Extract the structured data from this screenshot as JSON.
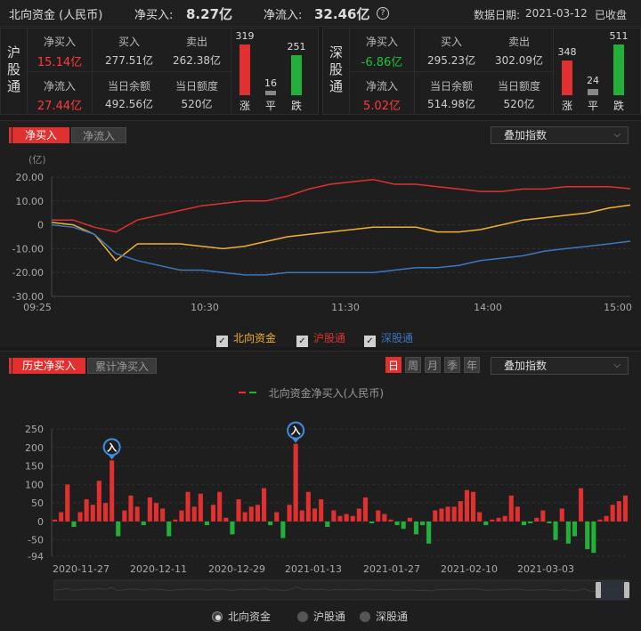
{
  "header": {
    "title": "北向资金 (人民币)",
    "net_buy_label": "净买入:",
    "net_buy_value": "8.27亿",
    "net_inflow_label": "净流入:",
    "net_inflow_value": "32.46亿",
    "help_icon": "?",
    "date_label": "数据日期:",
    "date_value": "2021-03-12",
    "status": "已收盘"
  },
  "sh": {
    "side_label": [
      "沪",
      "股",
      "通"
    ],
    "net_buy_label": "净买入",
    "net_buy_value": "15.14亿",
    "buy_label": "买入",
    "buy_value": "277.51亿",
    "sell_label": "卖出",
    "sell_value": "262.38亿",
    "net_inflow_label": "净流入",
    "net_inflow_value": "27.44亿",
    "balance_label": "当日余额",
    "balance_value": "492.56亿",
    "quota_label": "当日额度",
    "quota_value": "520亿",
    "up_count": "319",
    "flat_count": "16",
    "down_count": "251",
    "up_label": "涨",
    "flat_label": "平",
    "down_label": "跌"
  },
  "sz": {
    "side_label": [
      "深",
      "股",
      "通"
    ],
    "net_buy_label": "净买入",
    "net_buy_value": "-6.86亿",
    "buy_label": "买入",
    "buy_value": "295.23亿",
    "sell_label": "卖出",
    "sell_value": "302.09亿",
    "net_inflow_label": "净流入",
    "net_inflow_value": "5.02亿",
    "balance_label": "当日余额",
    "balance_value": "514.98亿",
    "quota_label": "当日额度",
    "quota_value": "520亿",
    "up_count": "348",
    "flat_count": "24",
    "down_count": "511",
    "up_label": "涨",
    "flat_label": "平",
    "down_label": "跌"
  },
  "intraday": {
    "tab_active": "净买入",
    "tab_inactive": "净流入",
    "overlay_select": "叠加指数",
    "legend": [
      {
        "label": "北向资金",
        "color": "#f0b030"
      },
      {
        "label": "沪股通",
        "color": "#e03030"
      },
      {
        "label": "深股通",
        "color": "#3a78c0"
      }
    ]
  },
  "history": {
    "tab_active": "历史净买入",
    "tab_inactive": "累计净买入",
    "periods": [
      "日",
      "周",
      "月",
      "季",
      "年"
    ],
    "active_period": "日",
    "overlay_select": "叠加指数",
    "legend_label": "北向资金净买入(人民币)",
    "marker_label": "入",
    "radio_options": [
      "北向资金",
      "沪股通",
      "深股通"
    ],
    "radio_selected": "北向资金"
  },
  "chart_data": [
    {
      "type": "line",
      "unit": "(亿)",
      "ylim": [
        -30,
        20
      ],
      "y_ticks": [
        "20.00",
        "10.00",
        "0",
        "-10.00",
        "-20.00",
        "-30.00"
      ],
      "x_ticks": [
        "09:25",
        "10:30",
        "11:30",
        "14:00",
        "15:00"
      ],
      "x": [
        "09:25",
        "09:30",
        "09:35",
        "09:40",
        "09:45",
        "09:50",
        "10:00",
        "10:10",
        "10:20",
        "10:30",
        "10:40",
        "10:50",
        "11:00",
        "11:10",
        "11:20",
        "11:30",
        "13:10",
        "13:20",
        "13:30",
        "13:40",
        "13:50",
        "14:00",
        "14:10",
        "14:20",
        "14:30",
        "14:40",
        "14:50",
        "15:00"
      ],
      "series": [
        {
          "name": "北向资金",
          "color": "#f0b030",
          "values": [
            1,
            0,
            -4,
            -15,
            -8,
            -8,
            -8,
            -9,
            -10,
            -9,
            -7,
            -5,
            -4,
            -3,
            -2,
            -1,
            -1,
            -1,
            -3,
            -3,
            -2,
            0,
            2,
            3,
            4,
            5,
            7,
            8.27
          ]
        },
        {
          "name": "沪股通",
          "color": "#e03030",
          "values": [
            2,
            2,
            -1,
            -3,
            2,
            4,
            6,
            8,
            9,
            10,
            10,
            12,
            15,
            17,
            18,
            19,
            17,
            17,
            16,
            15,
            14,
            14,
            15,
            15,
            16,
            16,
            16,
            15.14
          ]
        },
        {
          "name": "深股通",
          "color": "#3a78c0",
          "values": [
            0,
            -1,
            -4,
            -12,
            -15,
            -17,
            -19,
            -19,
            -20,
            -21,
            -21,
            -20,
            -20,
            -20,
            -20,
            -20,
            -19,
            -18,
            -18,
            -17,
            -15,
            -14,
            -13,
            -11,
            -10,
            -9,
            -8,
            -6.86
          ]
        }
      ]
    },
    {
      "type": "bar",
      "ylim": [
        -94,
        250
      ],
      "y_ticks": [
        "250",
        "200",
        "150",
        "100",
        "50",
        "0",
        "-50",
        "-94"
      ],
      "x_ticks": [
        "2020-11-27",
        "2020-12-11",
        "2020-12-29",
        "2021-01-13",
        "2021-01-27",
        "2021-02-10",
        "2021-03-03"
      ],
      "values": [
        5,
        25,
        100,
        -15,
        25,
        60,
        45,
        110,
        50,
        165,
        -40,
        30,
        70,
        40,
        -10,
        65,
        50,
        35,
        -40,
        5,
        30,
        80,
        40,
        75,
        -10,
        45,
        80,
        10,
        -35,
        60,
        25,
        40,
        45,
        90,
        -10,
        25,
        -45,
        45,
        210,
        30,
        80,
        35,
        60,
        -15,
        30,
        15,
        20,
        15,
        35,
        65,
        -5,
        30,
        20,
        5,
        -10,
        -20,
        10,
        -35,
        -10,
        -60,
        30,
        35,
        40,
        40,
        55,
        85,
        80,
        25,
        -10,
        5,
        10,
        15,
        70,
        40,
        -10,
        -5,
        10,
        30,
        -5,
        -50,
        35,
        -60,
        -40,
        90,
        -75,
        -85,
        5,
        15,
        45,
        55,
        70
      ],
      "markers": [
        9,
        38
      ]
    }
  ]
}
